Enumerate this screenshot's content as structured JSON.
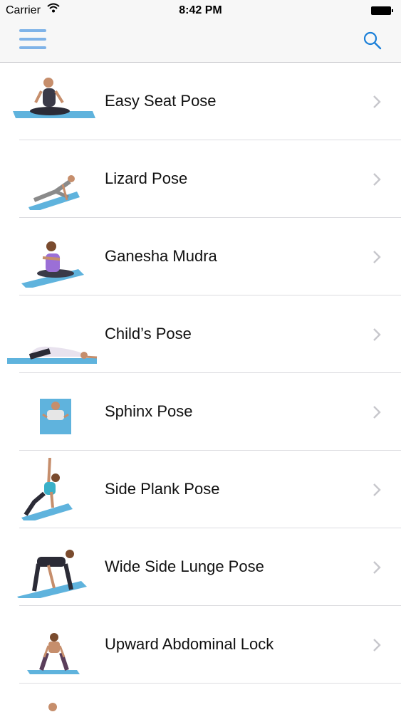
{
  "status_bar": {
    "carrier": "Carrier",
    "time": "8:42 PM"
  },
  "nav": {
    "menu_icon": "hamburger-menu-icon",
    "search_icon": "search-icon",
    "accent_color": "#1a7fd8"
  },
  "poses": [
    {
      "name": "Easy Seat Pose"
    },
    {
      "name": "Lizard Pose"
    },
    {
      "name": "Ganesha Mudra"
    },
    {
      "name": "Child’s Pose"
    },
    {
      "name": "Sphinx Pose"
    },
    {
      "name": "Side Plank Pose"
    },
    {
      "name": "Wide Side Lunge Pose"
    },
    {
      "name": "Upward Abdominal Lock"
    }
  ]
}
